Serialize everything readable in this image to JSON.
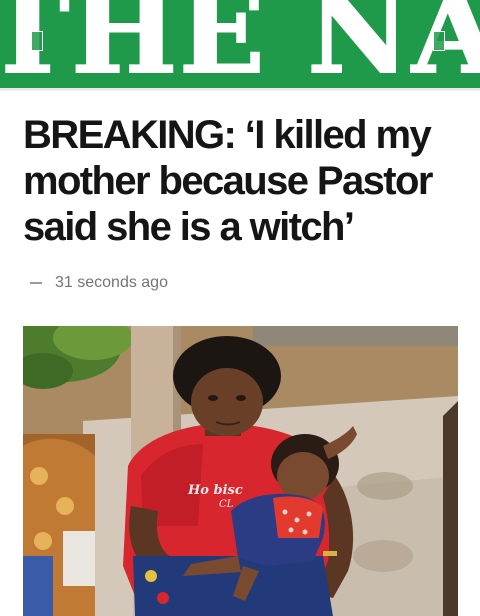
{
  "header": {
    "logo_text": "THE NATION",
    "menu_icon": "menu-icon",
    "search_icon": "search-icon",
    "brand_color": "#1f9a4a"
  },
  "article": {
    "headline": "BREAKING: ‘I killed my mother because Pastor said she is a witch’",
    "timestamp": "31 seconds ago",
    "image": {
      "shirt_text_line1": "Ho bisc",
      "shirt_text_line2": "CL"
    }
  }
}
